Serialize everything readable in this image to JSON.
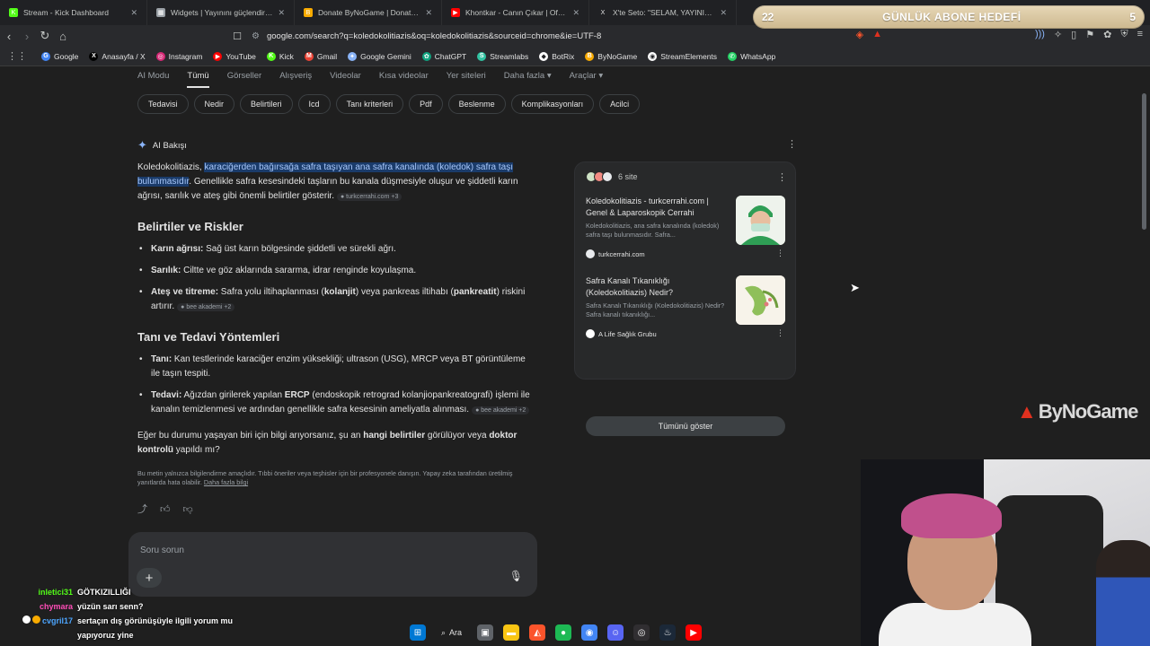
{
  "tabs": [
    {
      "label": "Stream - Kick Dashboard",
      "icon": "kick-icon",
      "color": "#53fc18"
    },
    {
      "label": "Widgets | Yayınını güçlendirmek için...",
      "icon": "widgets-icon",
      "color": "#9aa0a6"
    },
    {
      "label": "Donate ByNoGame | Donations",
      "icon": "bynogame-icon",
      "color": "#f9ab00"
    },
    {
      "label": "Khontkar - Canın Çıkar | Official V...",
      "icon": "youtube-icon",
      "color": "#ff0000"
    },
    {
      "label": "X'te Seto: \"SELAM, YAYINIMIZ AÇIKTI...",
      "icon": "x-icon",
      "color": "#e3e3e3"
    }
  ],
  "address": {
    "url": "google.com/search?q=koledokolitiazis&oq=koledokolitiazis&sourceid=chrome&ie=UTF-8"
  },
  "bookmarks": [
    {
      "label": "Google",
      "icon": "google-icon",
      "color": "#4285f4",
      "glyph": "G"
    },
    {
      "label": "Anasayfa / X",
      "icon": "x-icon",
      "color": "#000000",
      "glyph": "X"
    },
    {
      "label": "Instagram",
      "icon": "instagram-icon",
      "color": "#d62976",
      "glyph": "◎"
    },
    {
      "label": "YouTube",
      "icon": "youtube-icon",
      "color": "#ff0000",
      "glyph": "▶"
    },
    {
      "label": "Kick",
      "icon": "kick-icon",
      "color": "#53fc18",
      "glyph": "K"
    },
    {
      "label": "Gmail",
      "icon": "gmail-icon",
      "color": "#ea4335",
      "glyph": "M"
    },
    {
      "label": "Google Gemini",
      "icon": "gemini-icon",
      "color": "#8ab4f8",
      "glyph": "✦"
    },
    {
      "label": "ChatGPT",
      "icon": "chatgpt-icon",
      "color": "#10a37f",
      "glyph": "✿"
    },
    {
      "label": "Streamlabs",
      "icon": "streamlabs-icon",
      "color": "#31c3a2",
      "glyph": "S"
    },
    {
      "label": "BotRix",
      "icon": "botrix-icon",
      "color": "#ffffff",
      "glyph": "◆"
    },
    {
      "label": "ByNoGame",
      "icon": "bynogame-icon",
      "color": "#f9ab00",
      "glyph": "B"
    },
    {
      "label": "StreamElements",
      "icon": "streamelements-icon",
      "color": "#ffffff",
      "glyph": "◉"
    },
    {
      "label": "WhatsApp",
      "icon": "whatsapp-icon",
      "color": "#25d366",
      "glyph": "✆"
    }
  ],
  "goal": {
    "current": "22",
    "title": "GÜNLÜK ABONE HEDEFİ",
    "target": "5"
  },
  "search_tabs": [
    {
      "label": "AI Modu"
    },
    {
      "label": "Tümü",
      "active": true
    },
    {
      "label": "Görseller"
    },
    {
      "label": "Alışveriş"
    },
    {
      "label": "Videolar"
    },
    {
      "label": "Kısa videolar"
    },
    {
      "label": "Yer siteleri"
    },
    {
      "label": "Daha fazla ▾"
    },
    {
      "label": "Araçlar ▾"
    }
  ],
  "chips": [
    "Tedavisi",
    "Nedir",
    "Belirtileri",
    "Icd",
    "Tanı kriterleri",
    "Pdf",
    "Beslenme",
    "Komplikasyonları",
    "Acilci"
  ],
  "ai": {
    "header": "AI Bakışı",
    "intro_term": "Koledokolitiazis, ",
    "intro_highlight": "karaciğerden bağırsağa safra taşıyan ana safra kanalında (koledok) safra taşı bulunmasıdır",
    "intro_rest": ". Genellikle safra kesesindeki taşların bu kanala düşmesiyle oluşur ve şiddetli karın ağrısı, sarılık ve ateş gibi önemli belirtiler gösterir.",
    "intro_cite": "turkcerrahi.com +3",
    "section1": "Belirtiler ve Riskler",
    "s1_items": [
      {
        "bold": "Karın ağrısı:",
        "text": " Sağ üst karın bölgesinde şiddetli ve sürekli ağrı."
      },
      {
        "bold": "Sarılık:",
        "text": " Ciltte ve göz aklarında sararma, idrar renginde koyulaşma."
      }
    ],
    "s1_item3": {
      "bold": "Ateş ve titreme:",
      "t1": " Safra yolu iltihaplanması (",
      "b1": "kolanjit",
      "t2": ") veya pankreas iltihabı (",
      "b2": "pankreatit",
      "t3": ") riskini artırır.",
      "cite": "bee akademi +2"
    },
    "section2": "Tanı ve Tedavi Yöntemleri",
    "s2_item1": {
      "bold": "Tanı:",
      "text": " Kan testlerinde karaciğer enzim yüksekliği; ultrason (USG), MRCP veya BT görüntüleme ile taşın tespiti."
    },
    "s2_item2": {
      "bold": "Tedavi:",
      "t1": " Ağızdan girilerek yapılan ",
      "b1": "ERCP",
      "t2": " (endoskopik retrograd kolanjiopankreatografi) işlemi ile kanalın temizlenmesi ve ardından genellikle safra kesesinin ameliyatla alınması.",
      "cite": "bee akademi +2"
    },
    "question": {
      "t1": "Eğer bu durumu yaşayan biri için bilgi arıyorsanız, şu an ",
      "b1": "hangi belirtiler",
      "t2": " görülüyor veya ",
      "b2": "doktor kontrolü",
      "t3": " yapıldı mı?"
    },
    "disclaimer": "Bu metin yalnızca bilgilendirme amaçlıdır. Tıbbi öneriler veya teşhisler için bir profesyonele danışın. Yapay zeka tarafından üretilmiş yanıtlarda hata olabilir. ",
    "disclaimer_link": "Daha fazla bilgi",
    "ask_placeholder": "Soru sorun"
  },
  "sources": {
    "count": "6 site",
    "cards": [
      {
        "title": "Koledokolitiazis - turkcerrahi.com | Genel & Laparoskopik Cerrahi",
        "snippet": "Koledokolitiazis, ana safra kanalında (koledok) safra taşı bulunmasıdır. Safra...",
        "site": "turkcerrahi.com",
        "site_color": "#e8eaed",
        "thumb_color": "#cfe3c6"
      },
      {
        "title": "Safra Kanalı Tıkanıklığı (Koledokolitiazis) Nedir?",
        "snippet": "Safra Kanalı Tıkanıklığı (Koledokolitiazis) Nedir? Safra kanalı tıkanıklığı...",
        "site": "A Life Sağlık Grubu",
        "site_color": "#ffffff",
        "thumb_color": "#f3ecdc"
      }
    ],
    "show_all": "Tümünü göster"
  },
  "overlay": {
    "brand": "ByNoGame"
  },
  "chat": [
    {
      "user": "inletici31",
      "user_color": "#53fc18",
      "text": "GÖTKIZILLIĞI"
    },
    {
      "user": "chymara",
      "user_color": "#ff4db8",
      "text": "yüzün sarı senn?"
    },
    {
      "user": "cvgril17",
      "user_color": "#4da6ff",
      "text": "sertaçın dış görünüşüyle ilgili yorum mu yapıyoruz yine",
      "badges": [
        "#ffffff",
        "#f9ab00"
      ]
    }
  ],
  "taskbar": {
    "search_label": "Ara",
    "apps": [
      {
        "icon": "windows-start-icon",
        "color": "#0078d4"
      },
      {
        "icon": "task-view-icon",
        "color": "#5f6368"
      },
      {
        "icon": "file-explorer-icon",
        "color": "#f9c513"
      },
      {
        "icon": "brave-icon",
        "color": "#fb542b"
      },
      {
        "icon": "spotify-icon",
        "color": "#1db954"
      },
      {
        "icon": "chrome-icon",
        "color": "#4285f4"
      },
      {
        "icon": "discord-icon",
        "color": "#5865f2"
      },
      {
        "icon": "obs-icon",
        "color": "#302e31"
      },
      {
        "icon": "steam-icon",
        "color": "#1b2838"
      },
      {
        "icon": "youtube-music-icon",
        "color": "#ff0000"
      }
    ]
  }
}
